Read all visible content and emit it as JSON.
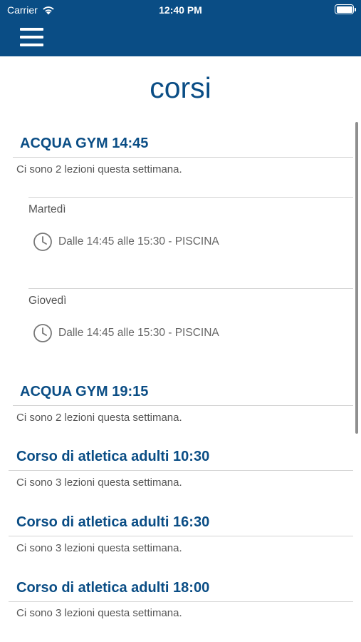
{
  "status_bar": {
    "carrier": "Carrier",
    "time": "12:40 PM"
  },
  "header": {
    "menu_icon": "hamburger-menu-icon",
    "color": "#0a4d85"
  },
  "page": {
    "title": "corsi"
  },
  "courses": [
    {
      "title": "ACQUA GYM 14:45",
      "summary": "Ci sono 2 lezioni questa settimana.",
      "expanded": true,
      "lessons": [
        {
          "day": "Martedì",
          "time": "Dalle 14:45 alle 15:30 - PISCINA"
        },
        {
          "day": "Giovedì",
          "time": "Dalle 14:45 alle 15:30 - PISCINA"
        }
      ]
    },
    {
      "title": "ACQUA GYM 19:15",
      "summary": "Ci sono 2 lezioni questa settimana."
    },
    {
      "title": "Corso di atletica adulti 10:30",
      "summary": "Ci sono 3 lezioni questa settimana."
    },
    {
      "title": "Corso di atletica adulti 16:30",
      "summary": "Ci sono 3 lezioni questa settimana."
    },
    {
      "title": "Corso di atletica adulti 18:00",
      "summary": "Ci sono 3 lezioni questa settimana."
    }
  ],
  "icons": {
    "lesson_time": "clock-icon"
  }
}
